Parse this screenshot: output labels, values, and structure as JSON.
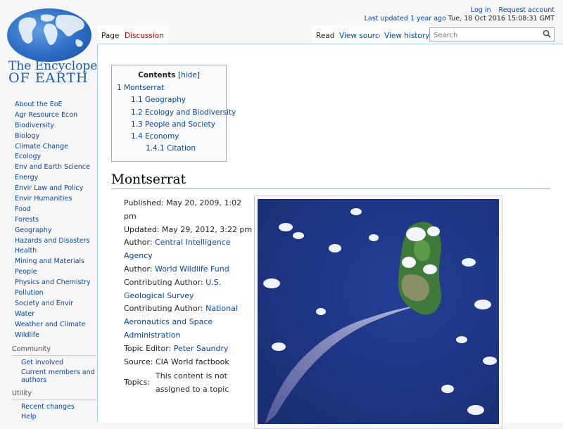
{
  "logo": {
    "line1": "The Encyclopedia",
    "line2": "OF EARTH"
  },
  "nav": [
    "About the EoE",
    "Agr Resource Econ",
    "Biodiversity",
    "Biology",
    "Climate Change",
    "Ecology",
    "Env and Earth Science",
    "Energy",
    "Envir Law and Policy",
    "Envir Humanities",
    "Food",
    "Forests",
    "Geography",
    "Hazards and Disasters",
    "Health",
    "Mining and Materials",
    "People",
    "Physics and Chemistry",
    "Pollution",
    "Society and Envir",
    "Water",
    "Weather and Climate",
    "Wildlife"
  ],
  "community": {
    "heading": "Community",
    "links": [
      "Get involved",
      "Current members and authors"
    ]
  },
  "utility": {
    "heading": "Utility",
    "links": [
      "Recent changes",
      "Help"
    ]
  },
  "personal": {
    "login": "Log in",
    "request": "Request account",
    "updated_prefix": "Last updated",
    "updated_rel": "1 year ago",
    "updated_date": "Tue, 18 Oct 2016 15:08:31 GMT"
  },
  "tabs": {
    "page": "Page",
    "discussion": "Discussion",
    "read": "Read",
    "view_source": "View source",
    "view_history": "View history"
  },
  "search": {
    "placeholder": "Search"
  },
  "toc": {
    "title": "Contents",
    "hide": "hide",
    "items": [
      "1 Montserrat",
      "1.1 Geography",
      "1.2 Ecology and Biodiversity",
      "1.3 People and Society",
      "1.4 Economy",
      "1.4.1 Citation"
    ]
  },
  "article": {
    "title": "Montserrat",
    "published": "Published: May 20, 2009, 1:02 pm",
    "updated": "Updated: May 29, 2012, 3:22 pm",
    "author_label": "Author: ",
    "author": "Central Intelligence Agency",
    "author2_label": "Author: ",
    "author2": "World Wildlife Fund",
    "contrib1_label": "Contributing Author: ",
    "contrib1": "U.S. Geological Survey",
    "contrib2_label": "Contributing Author: ",
    "contrib2": "National Aeronautics and Space Administration",
    "editor_label": "Topic Editor: ",
    "editor": "Peter Saundry",
    "source": "Source: CIA World factbook",
    "topics_label": "Topics:",
    "topics_value": "This content is not assigned to a topic"
  }
}
